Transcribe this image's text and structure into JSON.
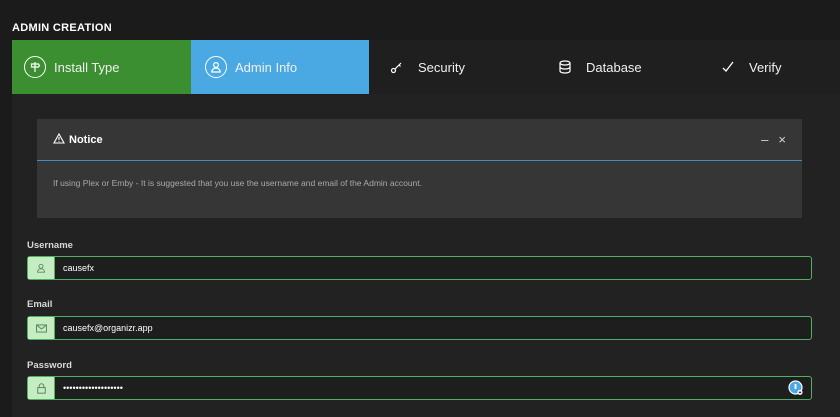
{
  "page": {
    "title": "ADMIN CREATION"
  },
  "steps": [
    {
      "label": "Install Type",
      "icon": "signpost-icon",
      "state": "complete",
      "color": "#3c8f31"
    },
    {
      "label": "Admin Info",
      "icon": "user-icon",
      "state": "active",
      "color": "#4aa8e2"
    },
    {
      "label": "Security",
      "icon": "key-icon",
      "state": "pending"
    },
    {
      "label": "Database",
      "icon": "database-icon",
      "state": "pending"
    },
    {
      "label": "Verify",
      "icon": "check-icon",
      "state": "pending"
    }
  ],
  "notice": {
    "title": "Notice",
    "icon": "warning-icon",
    "minimize": "–",
    "close": "×",
    "message": "If using Plex or Emby - It is suggested that you use the username and email of the Admin account."
  },
  "form": {
    "username": {
      "label": "Username",
      "value": "causefx",
      "icon": "user-icon"
    },
    "email": {
      "label": "Email",
      "value": "causefx@organizr.app",
      "icon": "envelope-icon"
    },
    "password": {
      "label": "Password",
      "value": "•••••••••••••••••••",
      "icon": "lock-icon"
    }
  },
  "colors": {
    "accent_green": "#4fb060",
    "accent_blue": "#4aa8e2"
  }
}
